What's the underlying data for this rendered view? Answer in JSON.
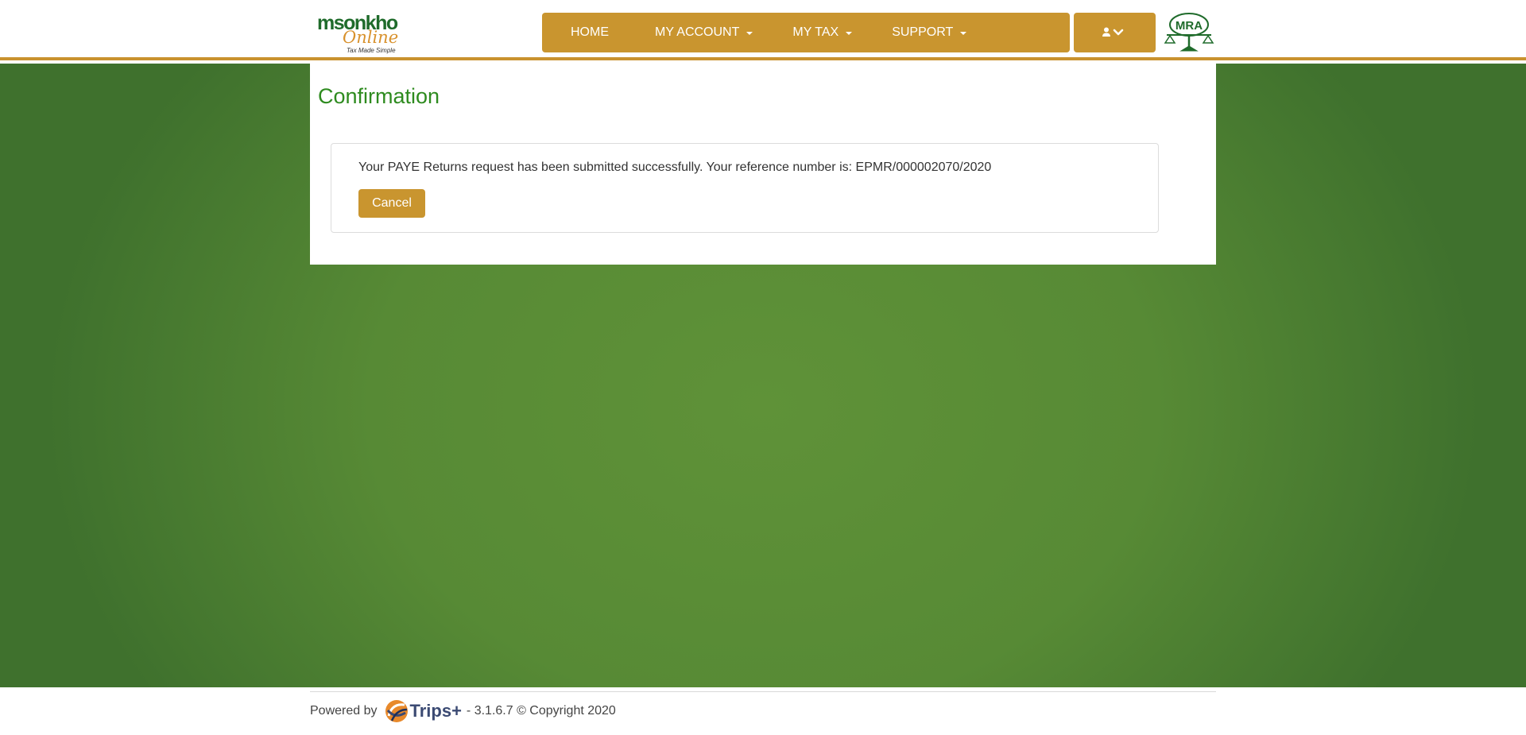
{
  "header": {
    "logo": {
      "name": "msonkho",
      "script": "Online",
      "tagline": "Tax Made Simple",
      "colors": {
        "green": "#1f6b2b",
        "orange": "#d8912c"
      }
    },
    "nav": {
      "home": "HOME",
      "my_account": "MY ACCOUNT",
      "my_tax": "MY TAX",
      "support": "SUPPORT"
    },
    "user_menu": {
      "icons": [
        "user-icon",
        "chevron-down-icon"
      ]
    },
    "authority_logo": {
      "text": "MRA",
      "icon": "scales-of-justice-icon"
    }
  },
  "page": {
    "title": "Confirmation",
    "message": "Your PAYE Returns request has been submitted successfully. Your reference number is: EPMR/000002070/2020",
    "cancel_label": "Cancel"
  },
  "footer": {
    "powered_by": "Powered by",
    "product": "Trips+",
    "version_copyright": "- 3.1.6.7 © Copyright 2020"
  },
  "colors": {
    "accent": "#c9952f",
    "title_green": "#2e8b1f",
    "background_green": "#578a35"
  }
}
